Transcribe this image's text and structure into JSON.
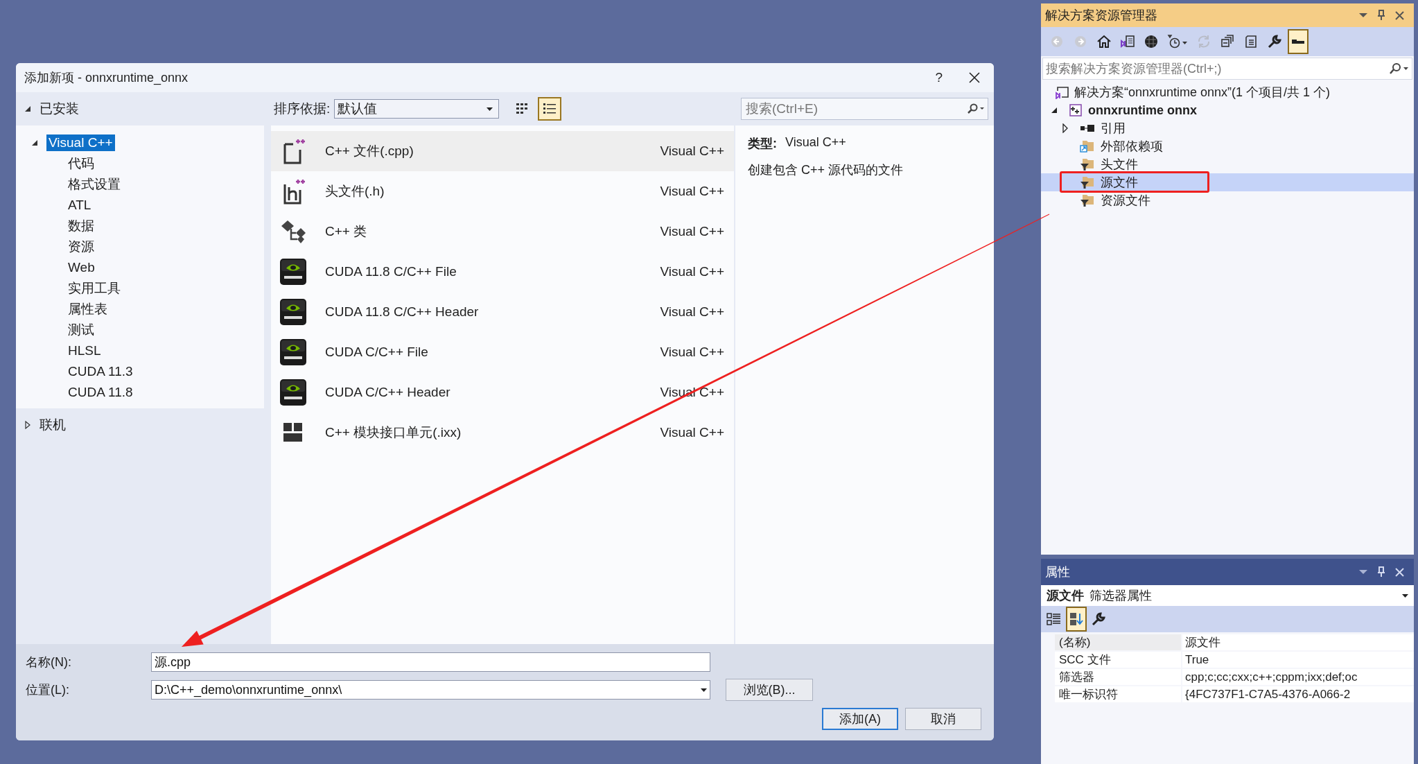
{
  "dialog": {
    "title": "添加新项 - onnxruntime_onnx",
    "help": "?",
    "categories": [
      {
        "label": "已安装",
        "expanded": true,
        "children": [
          {
            "label": "Visual C++",
            "expanded": true,
            "selected": true,
            "children": [
              {
                "label": "代码",
                "selected": false
              },
              {
                "label": "格式设置",
                "selected": false
              },
              {
                "label": "ATL",
                "selected": false
              },
              {
                "label": "数据",
                "selected": false
              },
              {
                "label": "资源",
                "selected": false
              },
              {
                "label": "Web",
                "selected": false
              },
              {
                "label": "实用工具",
                "selected": false
              },
              {
                "label": "属性表",
                "selected": false
              },
              {
                "label": "测试",
                "selected": false
              },
              {
                "label": "HLSL",
                "selected": false
              },
              {
                "label": "CUDA 11.3",
                "selected": false
              },
              {
                "label": "CUDA 11.8",
                "selected": false
              }
            ]
          }
        ]
      },
      {
        "label": "联机",
        "expanded": false
      }
    ],
    "sort": {
      "label": "排序依据:",
      "value": "默认值"
    },
    "view_toggles": [
      {
        "kind": "grid",
        "selected": false
      },
      {
        "kind": "list",
        "selected": true
      }
    ],
    "search": {
      "placeholder": "搜索(Ctrl+E)"
    },
    "templates": [
      {
        "kind": "cpp",
        "name": "C++ 文件(.cpp)",
        "language": "Visual C++",
        "selected": true
      },
      {
        "kind": "header",
        "name": "头文件(.h)",
        "language": "Visual C++",
        "selected": false
      },
      {
        "kind": "class",
        "name": "C++ 类",
        "language": "Visual C++",
        "selected": false
      },
      {
        "kind": "nvidia",
        "name": "CUDA 11.8 C/C++ File",
        "language": "Visual C++",
        "selected": false
      },
      {
        "kind": "nvidia",
        "name": "CUDA 11.8 C/C++ Header",
        "language": "Visual C++",
        "selected": false
      },
      {
        "kind": "nvidia",
        "name": "CUDA C/C++ File",
        "language": "Visual C++",
        "selected": false
      },
      {
        "kind": "nvidia",
        "name": "CUDA C/C++ Header",
        "language": "Visual C++",
        "selected": false
      },
      {
        "kind": "module",
        "name": "C++ 模块接口单元(.ixx)",
        "language": "Visual C++",
        "selected": false
      }
    ],
    "details": {
      "type_label": "类型:",
      "type_value": "Visual C++",
      "description": "创建包含 C++ 源代码的文件"
    },
    "name_field": {
      "label": "名称(N):",
      "value": "源.cpp"
    },
    "location_field": {
      "label": "位置(L):",
      "value": "D:\\C++_demo\\onnxruntime_onnx\\"
    },
    "browse_button": "浏览(B)...",
    "add_button": "添加(A)",
    "cancel_button": "取消"
  },
  "solution_explorer": {
    "title": "解决方案资源管理器",
    "toolbar": [
      {
        "kind": "back",
        "selected": false
      },
      {
        "kind": "forward",
        "selected": false
      },
      {
        "kind": "home",
        "selected": false
      },
      {
        "kind": "switch-views",
        "selected": false
      },
      {
        "kind": "globe",
        "selected": false
      },
      {
        "kind": "history",
        "selected": false
      },
      {
        "kind": "refresh",
        "selected": false
      },
      {
        "kind": "collapse",
        "selected": false
      },
      {
        "kind": "copy",
        "selected": false
      },
      {
        "kind": "wrench",
        "selected": false
      },
      {
        "kind": "preview",
        "selected": true
      }
    ],
    "search": {
      "placeholder": "搜索解决方案资源管理器(Ctrl+;)"
    },
    "solution": "解决方案“onnxruntime onnx”(1 个项目/共 1 个)",
    "project": {
      "label": "onnxruntime onnx",
      "expanded": true,
      "children": [
        {
          "kind": "references",
          "label": "引用",
          "expanded": false,
          "selected": false
        },
        {
          "kind": "external",
          "label": "外部依赖项",
          "selected": false
        },
        {
          "kind": "filter",
          "label": "头文件",
          "selected": false
        },
        {
          "kind": "filter",
          "label": "源文件",
          "selected": true
        },
        {
          "kind": "filter",
          "label": "资源文件",
          "selected": false
        }
      ]
    }
  },
  "properties": {
    "title": "属性",
    "object_name": "源文件",
    "object_type": "筛选器属性",
    "toolbar": [
      {
        "kind": "categorized",
        "selected": false
      },
      {
        "kind": "alphabetical",
        "selected": true
      },
      {
        "kind": "wrench",
        "selected": false
      }
    ],
    "rows": [
      {
        "name": "(名称)",
        "value": "源文件",
        "selected": true
      },
      {
        "name": "SCC 文件",
        "value": "True",
        "selected": false
      },
      {
        "name": "筛选器",
        "value": "cpp;c;cc;cxx;c++;cppm;ixx;def;oc",
        "selected": false
      },
      {
        "name": "唯一标识符",
        "value": "{4FC737F1-C7A5-4376-A066-2",
        "selected": false
      }
    ]
  }
}
